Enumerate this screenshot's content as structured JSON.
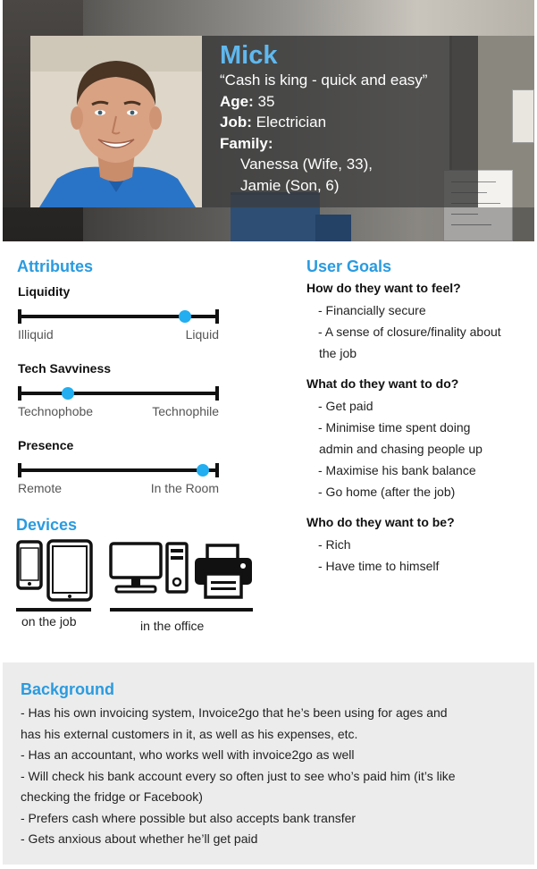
{
  "persona": {
    "name": "Mick",
    "quote": "“Cash is king - quick and easy”",
    "age_label": "Age:",
    "age_value": "35",
    "job_label": "Job:",
    "job_value": "Electrician",
    "family_label": "Family:",
    "family_members": [
      "Vanessa (Wife, 33),",
      "Jamie (Son, 6)"
    ]
  },
  "attributes": {
    "title": "Attributes",
    "items": [
      {
        "label": "Liquidity",
        "low": "Illiquid",
        "high": "Liquid",
        "level": 0.83
      },
      {
        "label": "Tech Savviness",
        "low": "Technophobe",
        "high": "Technophile",
        "level": 0.25
      },
      {
        "label": "Presence",
        "low": "Remote",
        "high": "In the Room",
        "level": 0.92
      }
    ]
  },
  "devices": {
    "title": "Devices",
    "groups": [
      {
        "caption": "on the job",
        "icons": [
          "smartphone-icon",
          "tablet-icon"
        ]
      },
      {
        "caption": "in the office",
        "icons": [
          "desktop-monitor-icon",
          "computer-tower-icon",
          "printer-icon"
        ]
      }
    ]
  },
  "user_goals": {
    "title": "User Goals",
    "groups": [
      {
        "question": "How do they want to feel?",
        "items": [
          "- Financially secure",
          "- A sense of closure/finality about",
          "the job"
        ]
      },
      {
        "question": "What do they want to do?",
        "items": [
          "- Get paid",
          "- Minimise time spent doing",
          "admin and chasing people up",
          "- Maximise his bank balance",
          "- Go home (after the job)"
        ]
      },
      {
        "question": "Who do they want to be?",
        "items": [
          "- Rich",
          "- Have time to himself"
        ]
      }
    ]
  },
  "background": {
    "title": "Background",
    "lines": [
      "- Has his own invoicing system, Invoice2go that he’s been using for ages and",
      "has his external customers in it, as well as his expenses, etc.",
      "- Has an accountant, who works well with invoice2go as well",
      "- Will check his bank account every so often just to see who’s paid him (it’s like",
      "checking the fridge or Facebook)",
      "- Prefers cash where possible but also accepts bank transfer",
      "- Gets anxious about whether he’ll get paid"
    ]
  },
  "colors": {
    "accent": "#2a9be0",
    "name": "#5fb8ef",
    "slider_knob": "#22aef0",
    "background_panel": "#ececec"
  }
}
